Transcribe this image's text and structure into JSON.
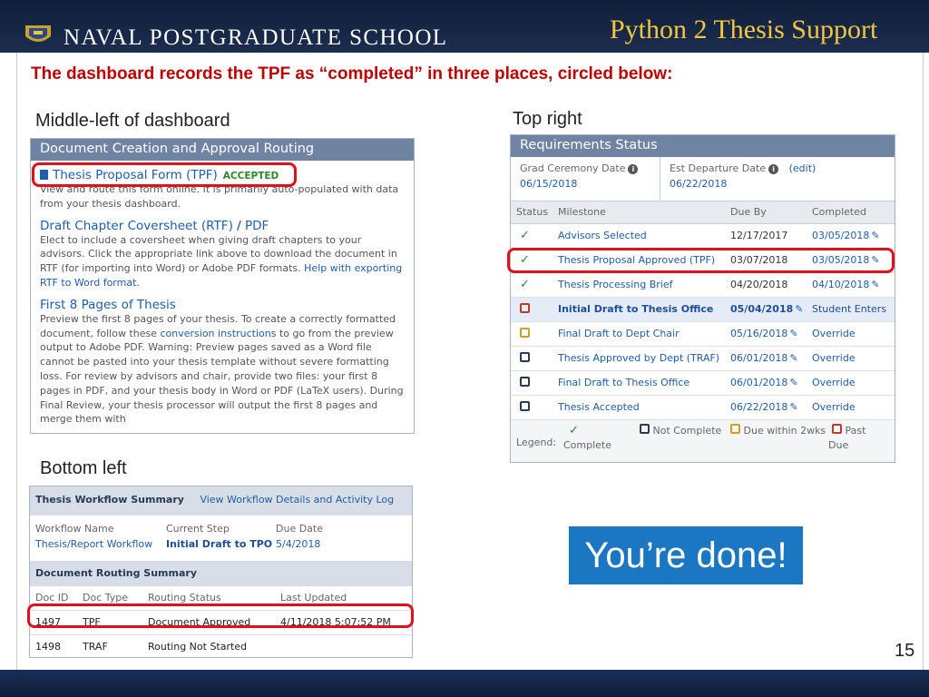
{
  "header": {
    "school_name": "NAVAL POSTGRADUATE SCHOOL",
    "deck_title": "Python 2 Thesis Support",
    "logo_icon": "nps-seal-icon"
  },
  "slide": {
    "subtitle": "The dashboard records the TPF as “completed” in three places, circled below:",
    "label_middle_left": "Middle-left of dashboard",
    "label_top_right": "Top right",
    "label_bottom_left": "Bottom left",
    "done_message": "You’re done!",
    "page_number": "15"
  },
  "doc_panel": {
    "title": "Document Creation and Approval Routing",
    "tpf_link": "Thesis Proposal Form (TPF)",
    "tpf_status": "ACCEPTED",
    "tpf_desc": "View and route this form online. It is primarily auto-populated with data from your thesis dashboard.",
    "rtf_link": "Draft Chapter Coversheet (RTF)",
    "rtf_sep": "/",
    "pdf_link": "PDF",
    "rtf_desc": "Elect to include a coversheet when giving draft chapters to your advisors. Click the appropriate link above to download the document in RTF (for importing into Word) or Adobe PDF formats.",
    "rtf_help_link": "Help with exporting RTF to Word format",
    "first8_link": "First 8 Pages of Thesis",
    "first8_desc_1": "Preview the first 8 pages of your thesis. To create a correctly formatted document, follow these",
    "first8_conv_link": "conversion instructions",
    "first8_desc_2": "to go from the preview output to Adobe PDF. Warning: Preview pages saved as a Word file cannot be pasted into your thesis template without severe formatting loss. For review by advisors and chair, provide two files: your first 8 pages in PDF, and your thesis body in Word or PDF (LaTeX users). During Final Review, your thesis processor will output the first 8 pages and merge them with"
  },
  "requirements": {
    "title": "Requirements Status",
    "grad_label": "Grad Ceremony Date",
    "grad_value": "06/15/2018",
    "depart_label": "Est Departure Date",
    "depart_value": "06/22/2018",
    "edit_link": "(edit)",
    "columns": [
      "Status",
      "Milestone",
      "Due By",
      "Completed"
    ],
    "rows": [
      {
        "status": "complete",
        "milestone": "Advisors Selected",
        "due": "12/17/2017",
        "completed": "03/05/2018"
      },
      {
        "status": "complete",
        "milestone": "Thesis Proposal Approved (TPF)",
        "due": "03/07/2018",
        "completed": "03/05/2018"
      },
      {
        "status": "complete",
        "milestone": "Thesis Processing Brief",
        "due": "04/20/2018",
        "completed": "04/10/2018"
      },
      {
        "status": "past-due",
        "milestone": "Initial Draft to Thesis Office",
        "due": "05/04/2018",
        "completed": "Student Enters"
      },
      {
        "status": "due-soon",
        "milestone": "Final Draft to Dept Chair",
        "due": "05/16/2018",
        "completed": "Override"
      },
      {
        "status": "not-complete",
        "milestone": "Thesis Approved by Dept (TRAF)",
        "due": "06/01/2018",
        "completed": "Override"
      },
      {
        "status": "not-complete",
        "milestone": "Final Draft to Thesis Office",
        "due": "06/01/2018",
        "completed": "Override"
      },
      {
        "status": "not-complete",
        "milestone": "Thesis Accepted",
        "due": "06/22/2018",
        "completed": "Override"
      }
    ],
    "legend_title": "Legend:",
    "legend": [
      "Complete",
      "Not Complete",
      "Due within 2wks",
      "Past Due"
    ],
    "colors": {
      "complete": "#2b8a2b",
      "not-complete": "#2a3b55",
      "due-soon": "#c9a227",
      "past-due": "#c0392b"
    }
  },
  "workflow": {
    "title": "Thesis Workflow Summary",
    "details_link": "View Workflow Details and Activity Log",
    "name_label": "Workflow Name",
    "name_value": "Thesis/Report Workflow",
    "step_label": "Current Step",
    "step_value": "Initial Draft to TPO",
    "due_label": "Due Date",
    "due_value": "5/4/2018",
    "routing_title": "Document Routing Summary",
    "columns": [
      "Doc ID",
      "Doc Type",
      "Routing Status",
      "Last Updated"
    ],
    "rows": [
      {
        "id": "1497",
        "type": "TPF",
        "status": "Document Approved",
        "updated": "4/11/2018 5:07:52 PM"
      },
      {
        "id": "1498",
        "type": "TRAF",
        "status": "Routing Not Started",
        "updated": ""
      }
    ]
  },
  "accent": {
    "red_circle": "#e0101c",
    "done_box": "#1c77c3",
    "deck_title": "#f3c542"
  }
}
